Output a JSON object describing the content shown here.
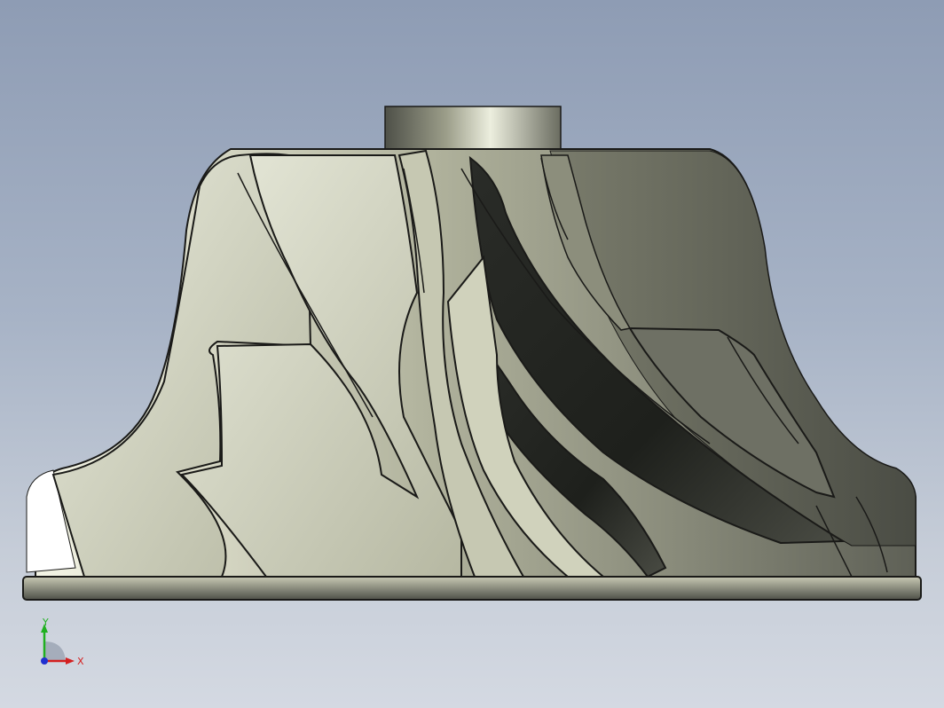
{
  "viewport": {
    "background_top": "#8e9cb4",
    "background_bottom": "#d4d9e2"
  },
  "model": {
    "part": "impeller",
    "icon": "impeller-3d-model",
    "metal_light": "#e6e8d8",
    "metal_mid": "#b4b59e",
    "metal_dark": "#4a4c44",
    "blade_count_visible": 8
  },
  "triad": {
    "x_label": "X",
    "y_label": "Y",
    "x_color": "#d42020",
    "y_color": "#20b020",
    "z_color": "#2030d0"
  }
}
